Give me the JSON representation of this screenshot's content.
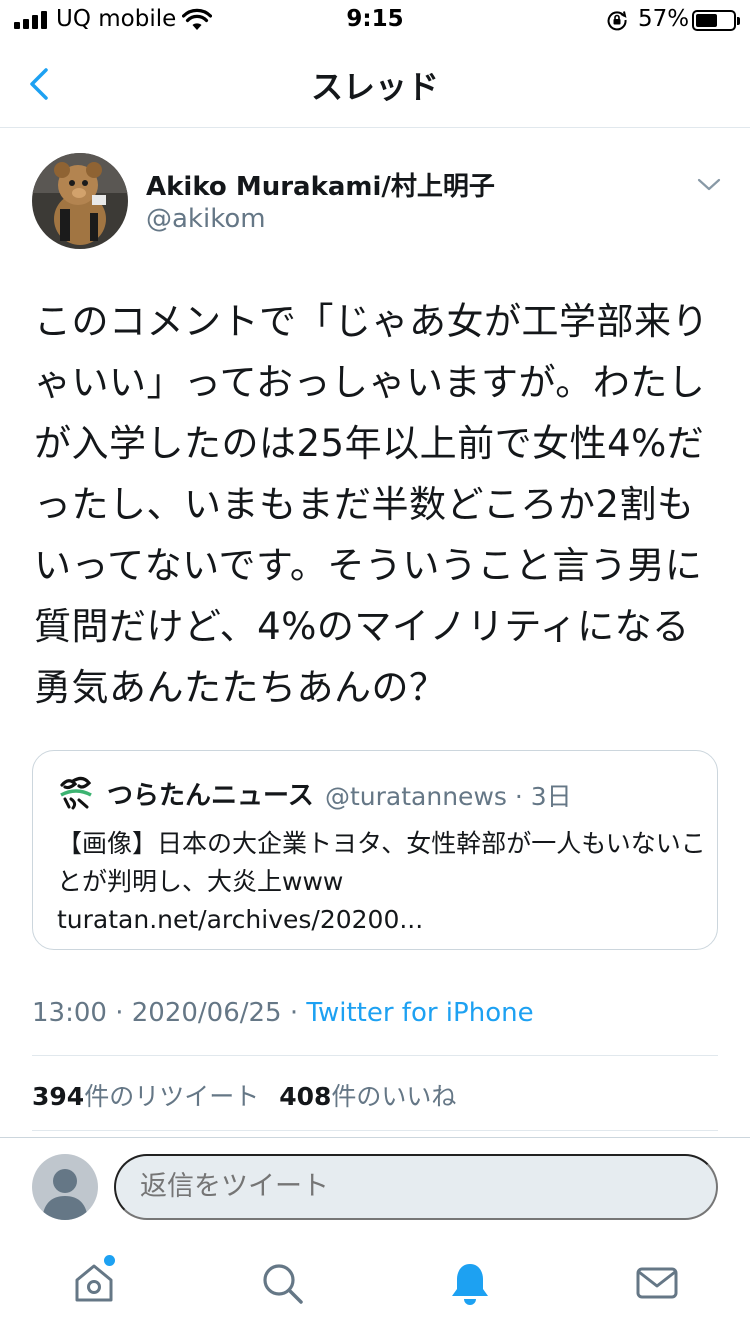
{
  "status_bar": {
    "carrier": "UQ mobile",
    "time": "9:15",
    "battery_percent": "57%",
    "battery_level": 0.57
  },
  "nav": {
    "title": "スレッド"
  },
  "tweet": {
    "author_name": "Akiko Murakami/村上明子",
    "author_handle": "@akikom",
    "text": "このコメントで「じゃあ女が工学部来りゃいい」っておっしゃいますが。わたしが入学したのは25年以上前で女性4%だったし、いまもまだ半数どころか2割もいってないです。そういうこと言う男に質問だけど、4%のマイノリティになる勇気あんたたちあんの？",
    "time": "13:00",
    "date": "2020/06/25",
    "source": "Twitter for iPhone",
    "retweets_count": "394",
    "retweets_label": "件のリツイート",
    "likes_count": "408",
    "likes_label": "件のいいね"
  },
  "quote": {
    "name": "つらたんニュース",
    "handle": "@turatannews",
    "age": "3日",
    "text": "【画像】日本の大企業トヨタ、女性幹部が一人もいないことが判明し、大炎上www turatan.net/archives/20200..."
  },
  "reply": {
    "placeholder": "返信をツイート"
  },
  "tabs": [
    "home-icon",
    "search-icon",
    "notifications-icon",
    "messages-icon"
  ],
  "colors": {
    "accent": "#1da1f2",
    "secondary_text": "#657786"
  }
}
